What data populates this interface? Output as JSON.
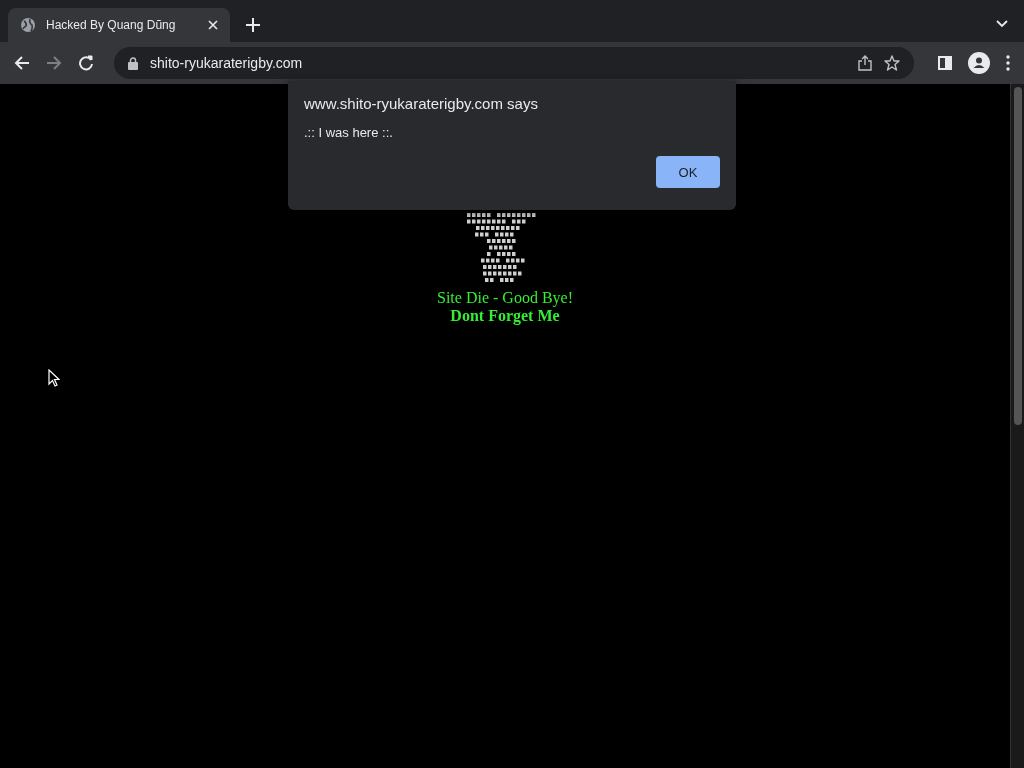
{
  "tabs": [
    {
      "title": "Hacked By Quang Dũng",
      "selected": true
    }
  ],
  "address_bar": {
    "url": "shito-ryukaraterigby.com"
  },
  "page": {
    "lines": [
      {
        "text": "Site Die - Good Bye!",
        "bold": false
      },
      {
        "text": "Dont Forget Me",
        "bold": true
      }
    ]
  },
  "dialog": {
    "title": "www.shito-ryukaraterigby.com says",
    "message": ".:: I was here ::.",
    "buttons": [
      "OK"
    ]
  }
}
